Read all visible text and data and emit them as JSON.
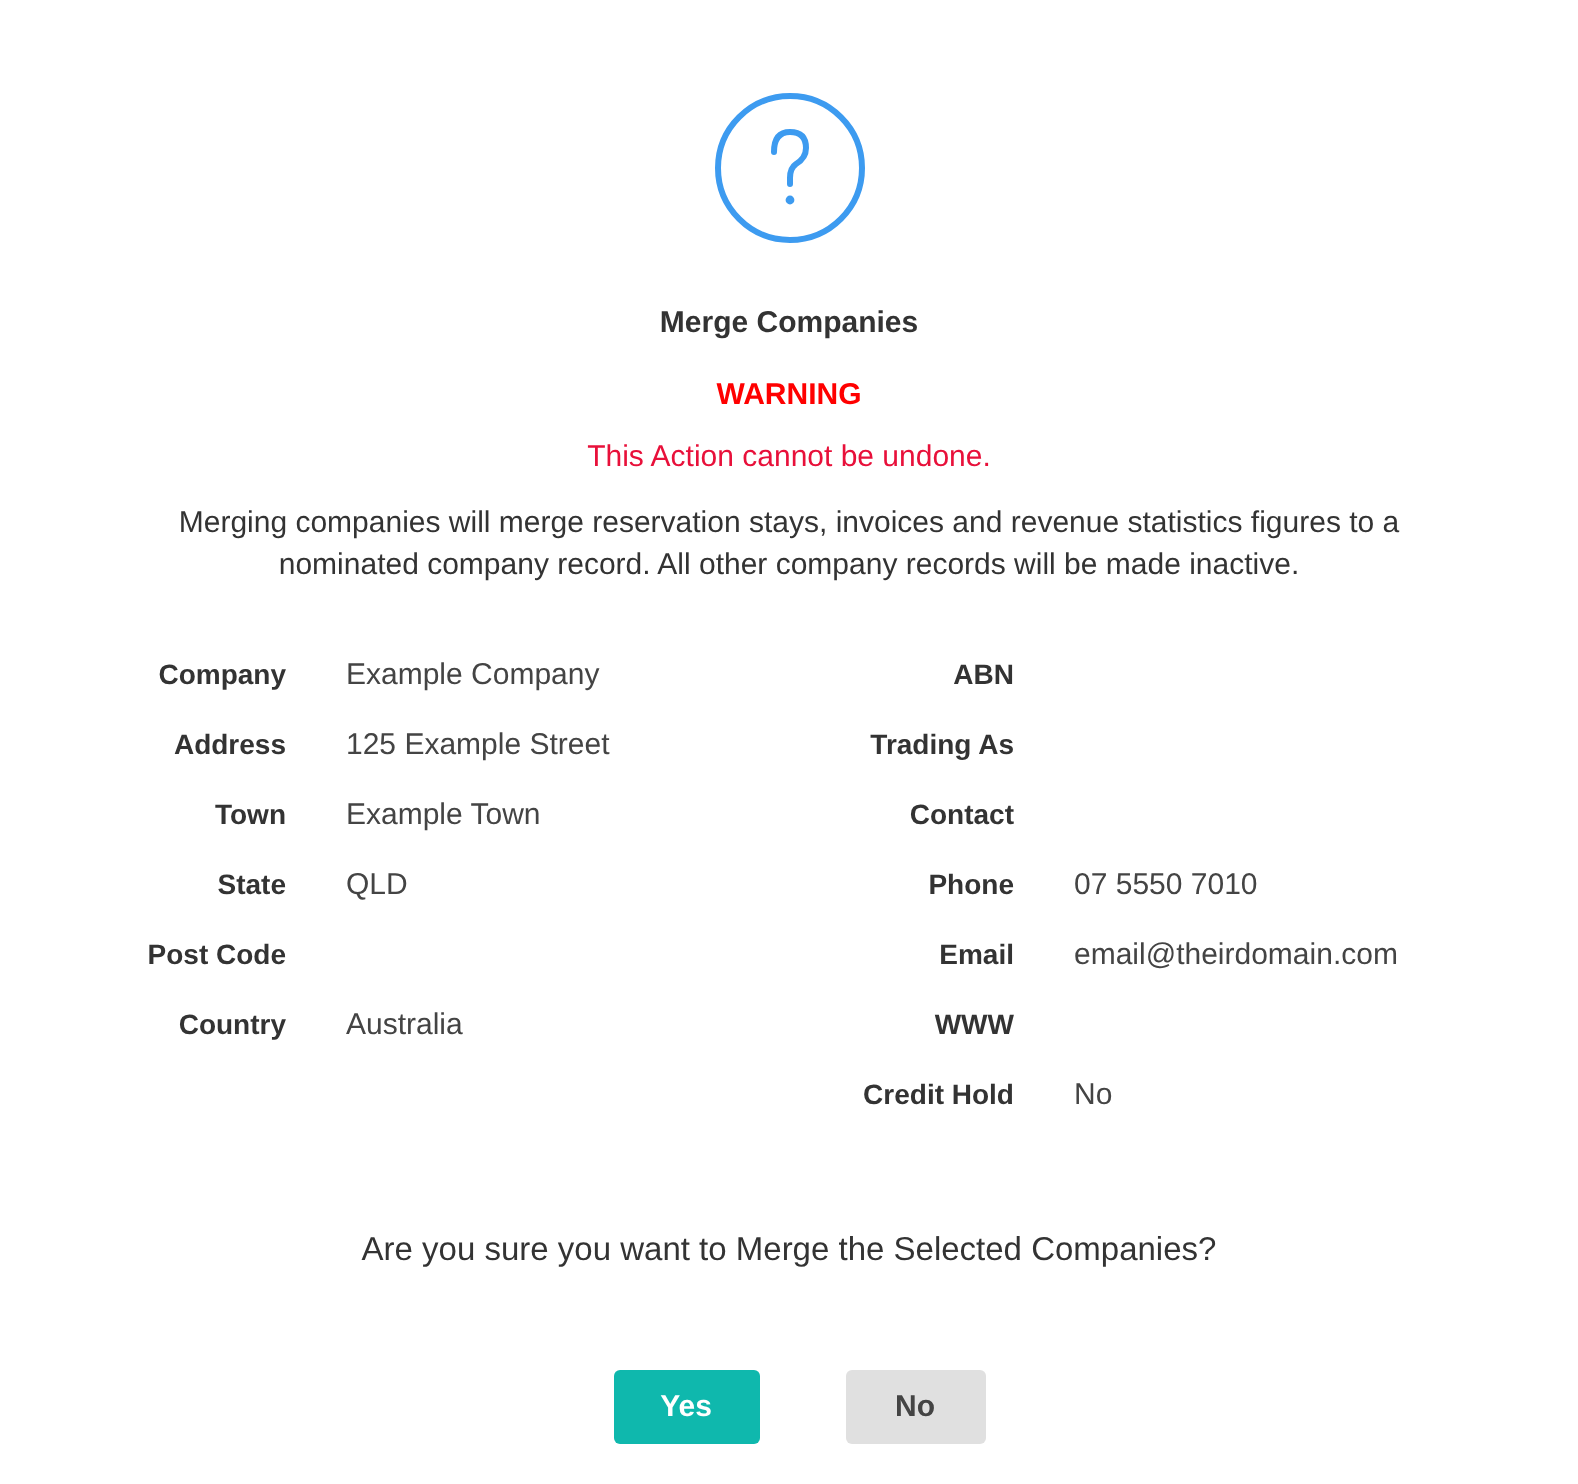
{
  "dialog": {
    "title": "Merge Companies",
    "warning": "WARNING",
    "subtitle": "This Action cannot be undone.",
    "description": "Merging companies will merge reservation stays, invoices and revenue statistics figures to a nominated company record. All other company records will be made inactive."
  },
  "left_fields": [
    {
      "label": "Company",
      "value": "Example Company"
    },
    {
      "label": "Address",
      "value": "125 Example Street"
    },
    {
      "label": "Town",
      "value": "Example Town"
    },
    {
      "label": "State",
      "value": "QLD"
    },
    {
      "label": "Post Code"
    },
    {
      "label": "Country",
      "value": "Australia"
    }
  ],
  "right_fields": [
    {
      "label": "ABN"
    },
    {
      "label": "Trading As"
    },
    {
      "label": "Contact"
    },
    {
      "label": "Phone",
      "value": "07 5550 7010"
    },
    {
      "label": "Email",
      "value": "email@theirdomain.com"
    },
    {
      "label": "WWW"
    },
    {
      "label": "Credit Hold",
      "value": "No"
    }
  ],
  "question": "Are you sure you want to Merge the Selected Companies?",
  "buttons": [
    {
      "label": "Yes",
      "kind": "primary"
    },
    {
      "label": "No",
      "kind": "secondary"
    }
  ]
}
